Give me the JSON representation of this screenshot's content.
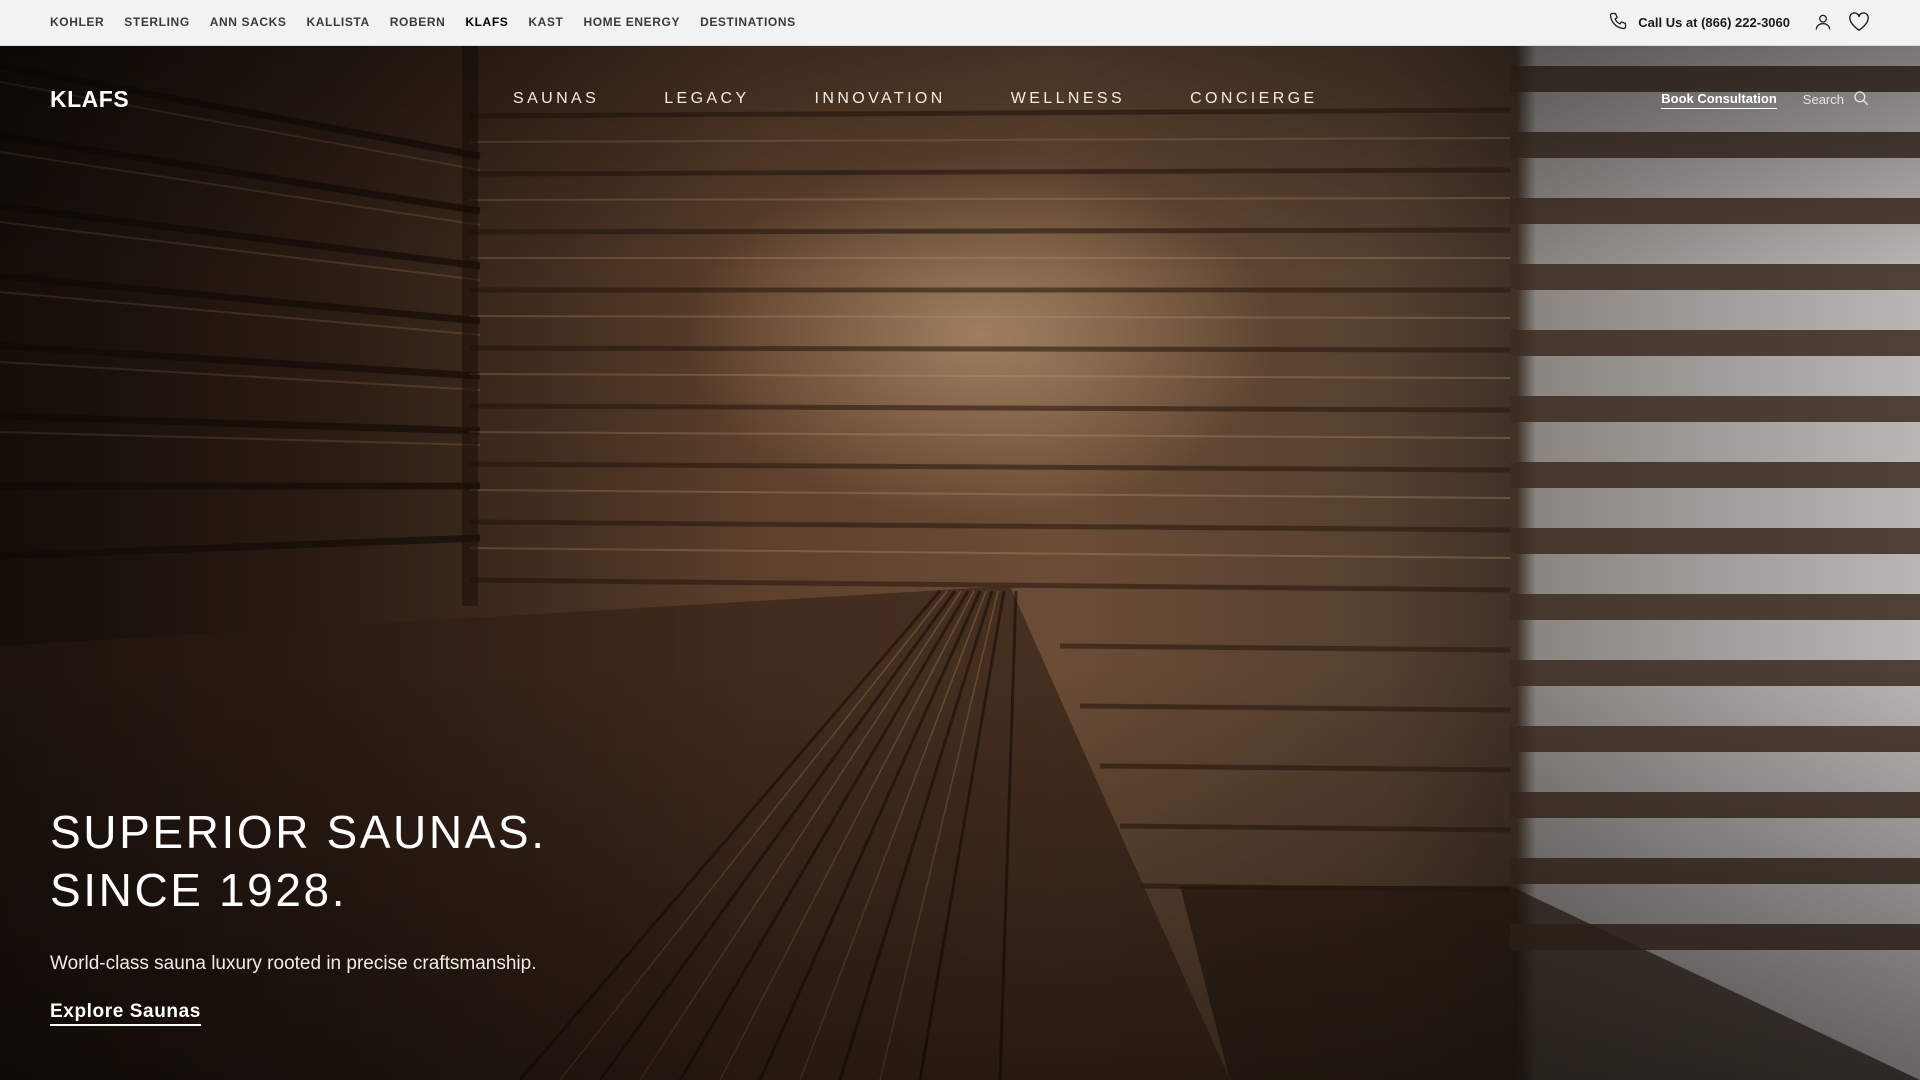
{
  "utility_bar": {
    "brands": [
      {
        "label": "KOHLER"
      },
      {
        "label": "STERLING"
      },
      {
        "label": "ANN SACKS"
      },
      {
        "label": "KALLISTA"
      },
      {
        "label": "ROBERN"
      },
      {
        "label": "KLAFS",
        "active": true
      },
      {
        "label": "KAST"
      },
      {
        "label": "HOME ENERGY"
      },
      {
        "label": "DESTINATIONS"
      }
    ],
    "call_label": "Call Us at (866) 222-3060",
    "icons": {
      "phone": "phone-icon",
      "account": "user-icon",
      "favorites": "heart-icon"
    }
  },
  "main_nav": {
    "logo": "KLAFS",
    "links": [
      "SAUNAS",
      "LEGACY",
      "INNOVATION",
      "WELLNESS",
      "CONCIERGE"
    ],
    "book_label": "Book Consultation",
    "search_label": "Search"
  },
  "hero": {
    "headline_line1": "SUPERIOR SAUNAS.",
    "headline_line2": "SINCE 1928.",
    "subhead": "World-class sauna luxury rooted in precise craftsmanship.",
    "cta_label": "Explore Saunas"
  },
  "colors": {
    "utility_bg": "#f2f2f2",
    "text_dark": "#1a1a1a",
    "hero_wood_dark": "#24170f",
    "hero_wood_light": "#6b4d36",
    "text_light": "#ffffff"
  }
}
